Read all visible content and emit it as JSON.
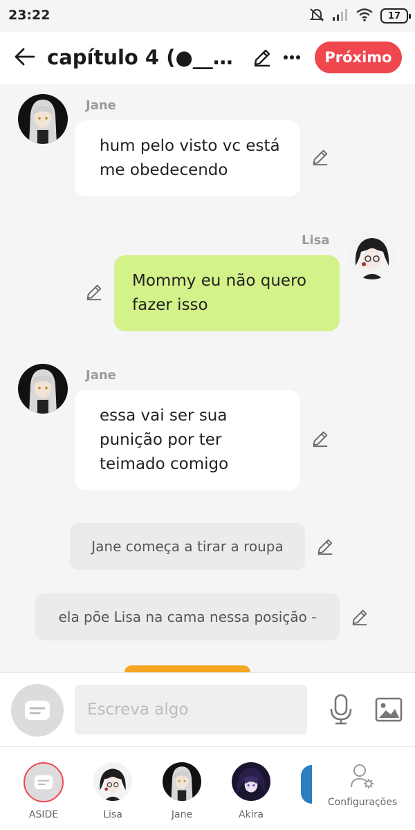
{
  "status_bar": {
    "time": "23:22",
    "battery": "17"
  },
  "header": {
    "title": "capítulo 4  (●__●...",
    "next_label": "Próximo"
  },
  "messages": [
    {
      "speaker": "Jane",
      "lines": [
        "hum pelo visto vc está",
        "me obedecendo"
      ]
    },
    {
      "speaker": "Lisa",
      "lines": [
        "Mommy eu não quero",
        "fazer isso"
      ]
    },
    {
      "speaker": "Jane",
      "lines": [
        "essa vai ser sua",
        "punição por ter",
        "teimado comigo"
      ]
    }
  ],
  "narrations": [
    "Jane começa a tirar a roupa",
    "ela põe Lisa na cama nessa posição -"
  ],
  "input": {
    "placeholder": "Escreva algo"
  },
  "nav": {
    "aside_label": "ASIDE",
    "lisa_label": "Lisa",
    "jane_label": "Jane",
    "akira_label": "Akira",
    "settings_label": "Configurações"
  },
  "colors": {
    "accent": "#f0474f",
    "my_bubble": "#d4f28a",
    "other_bubble": "#ffffff"
  },
  "icons": [
    "back-arrow-icon",
    "pencil-icon",
    "more-icon",
    "mic-icon",
    "image-icon",
    "chat-icon",
    "settings-icon",
    "mute-icon",
    "signal-icon",
    "wifi-icon"
  ]
}
